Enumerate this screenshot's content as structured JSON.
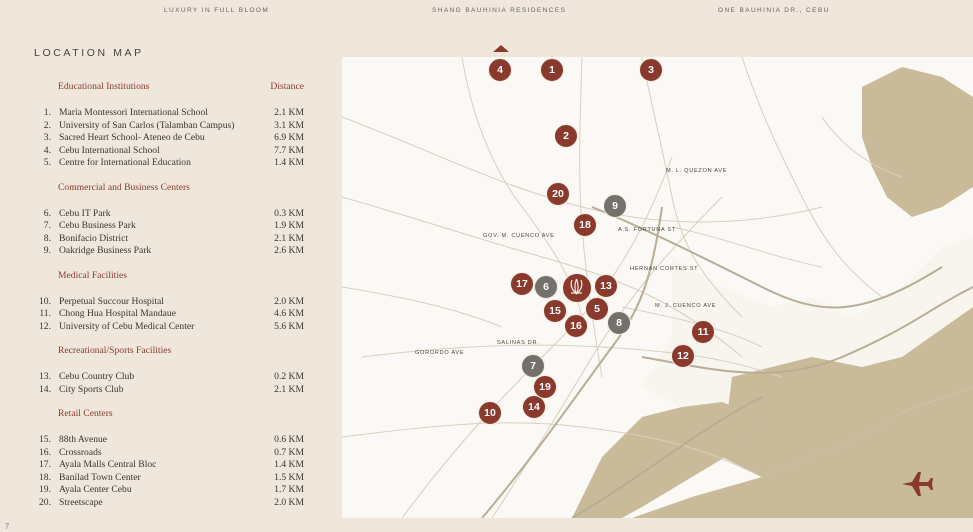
{
  "header": {
    "left": "LUXURY IN FULL BLOOM",
    "center": "SHANG BAUHINIA RESIDENCES",
    "right": "ONE BAUHINIA DR., CEBU"
  },
  "title": "LOCATION MAP",
  "distance_label": "Distance",
  "sections": [
    {
      "category": "Educational Institutions",
      "items": [
        {
          "n": "1.",
          "name": "Maria Montessori International School",
          "km": "2.1 KM"
        },
        {
          "n": "2.",
          "name": "University of San Carlos (Talamban Campus)",
          "km": "3.1 KM"
        },
        {
          "n": "3.",
          "name": "Sacred Heart School- Ateneo de Cebu",
          "km": "6.9 KM"
        },
        {
          "n": "4.",
          "name": "Cebu International School",
          "km": "7.7 KM"
        },
        {
          "n": "5.",
          "name": "Centre for International Education",
          "km": "1.4 KM"
        }
      ]
    },
    {
      "category": "Commercial and Business Centers",
      "items": [
        {
          "n": "6.",
          "name": "Cebu IT Park",
          "km": "0.3 KM"
        },
        {
          "n": "7.",
          "name": "Cebu Business Park",
          "km": "1.9 KM"
        },
        {
          "n": "8.",
          "name": "Bonifacio District",
          "km": "2.1 KM"
        },
        {
          "n": "9.",
          "name": "Oakridge Business Park",
          "km": "2.6 KM"
        }
      ]
    },
    {
      "category": "Medical Facilities",
      "items": [
        {
          "n": "10.",
          "name": "Perpetual Succour Hospital",
          "km": "2.0 KM"
        },
        {
          "n": "11.",
          "name": "Chong Hua Hospital Mandaue",
          "km": "4.6 KM"
        },
        {
          "n": "12.",
          "name": "University of Cebu Medical Center",
          "km": "5.6 KM"
        }
      ]
    },
    {
      "category": "Recreational/Sports Facilities",
      "items": [
        {
          "n": "13.",
          "name": "Cebu Country Club",
          "km": "0.2 KM"
        },
        {
          "n": "14.",
          "name": "City Sports Club",
          "km": "2.1 KM"
        }
      ]
    },
    {
      "category": "Retail Centers",
      "items": [
        {
          "n": "15.",
          "name": "88th Avenue",
          "km": "0.6 KM"
        },
        {
          "n": "16.",
          "name": "Crossroads",
          "km": "0.7 KM"
        },
        {
          "n": "17.",
          "name": "Ayala Malls Central Bloc",
          "km": "1.4 KM"
        },
        {
          "n": "18.",
          "name": "Banilad Town Center",
          "km": "1.5 KM"
        },
        {
          "n": "19.",
          "name": "Ayala Center Cebu",
          "km": "1.7 KM"
        },
        {
          "n": "20.",
          "name": "Streetscape",
          "km": "2.0 KM"
        }
      ]
    }
  ],
  "map": {
    "streets": [
      "M. L. QUEZON AVE",
      "A.S. FORTUNA ST",
      "GOV. M. CUENCO AVE",
      "HERNAN CORTES ST",
      "M. J. CUENCO AVE",
      "SALINAS DR.",
      "GORORDO AVE"
    ],
    "pins": [
      "1",
      "2",
      "3",
      "4",
      "5",
      "6",
      "7",
      "8",
      "9",
      "10",
      "11",
      "12",
      "13",
      "14",
      "15",
      "16",
      "17",
      "18",
      "19",
      "20"
    ],
    "airport_icon": "airplane-icon",
    "logo_icon": "bauhinia-logo-icon"
  },
  "colors": {
    "accent": "#8a3a2c",
    "grey_pin": "#74706b",
    "sea": "#c9bb9a",
    "background": "#efe7dc"
  },
  "page_number": "7"
}
